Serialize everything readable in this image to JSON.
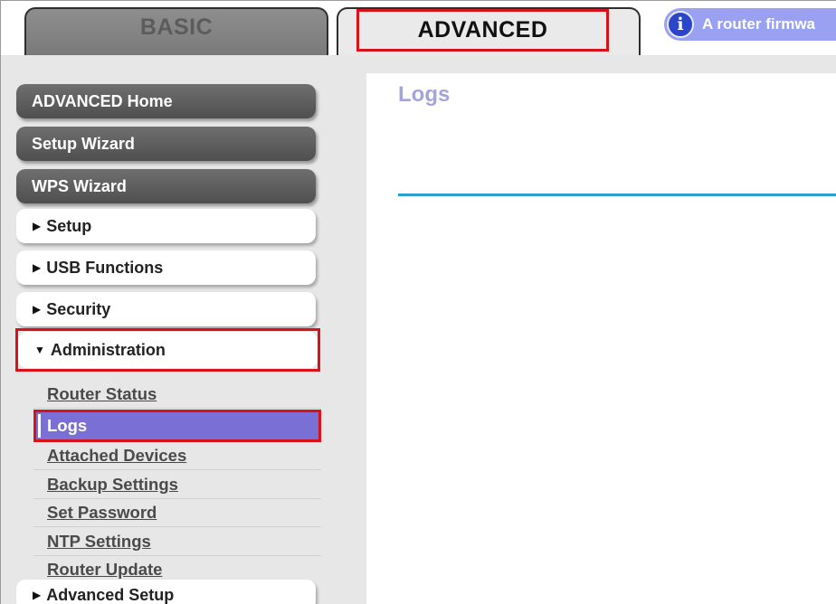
{
  "tabs": {
    "basic": "BASIC",
    "advanced": "ADVANCED"
  },
  "notice": {
    "icon": "i",
    "text": "A router firmwa"
  },
  "sidebar": {
    "dark_buttons": [
      {
        "label": "ADVANCED Home"
      },
      {
        "label": "Setup Wizard"
      },
      {
        "label": "WPS Wizard"
      }
    ],
    "sections": [
      {
        "label": "Setup",
        "expanded": false
      },
      {
        "label": "USB Functions",
        "expanded": false
      },
      {
        "label": "Security",
        "expanded": false
      },
      {
        "label": "Administration",
        "expanded": true
      }
    ],
    "admin_items": [
      {
        "label": "Router Status"
      },
      {
        "label": "Logs",
        "active": true
      },
      {
        "label": "Attached Devices"
      },
      {
        "label": "Backup Settings"
      },
      {
        "label": "Set Password"
      },
      {
        "label": "NTP Settings"
      },
      {
        "label": "Router Update"
      }
    ],
    "after_section": {
      "label": "Advanced Setup",
      "expanded": false
    }
  },
  "content": {
    "title": "Logs"
  },
  "colors": {
    "highlight": "#d8121b",
    "active_item": "#7a6fd4",
    "title": "#a4a4dc",
    "rule": "#2aa0d0",
    "notice_bg": "#9aa0f2"
  }
}
